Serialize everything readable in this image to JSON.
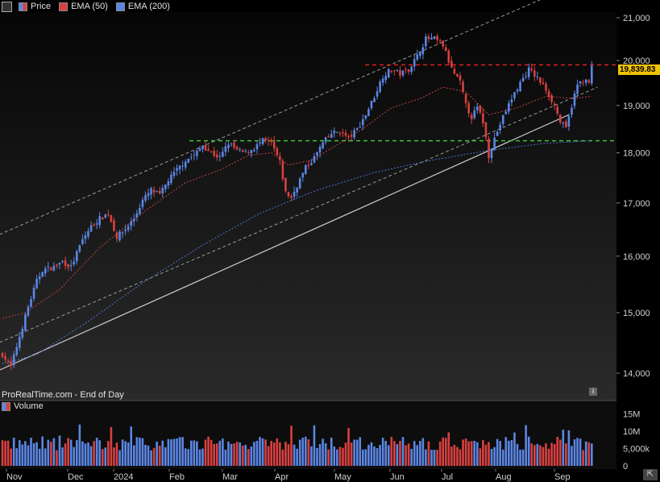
{
  "legend": [
    {
      "label": "Price",
      "color": "#d94040"
    },
    {
      "label": "EMA (50)",
      "color": "#d94040"
    },
    {
      "label": "EMA (200)",
      "color": "#5b86e5"
    }
  ],
  "source_label": "ProRealTime.com - End of Day",
  "volume_label": "Volume",
  "price_badge": "19,839.83",
  "colors": {
    "up": "#5b86e5",
    "down": "#d94040",
    "resistance": "#e02020",
    "support": "#3cc33c"
  },
  "chart_data": {
    "type": "candlestick",
    "price_axis": {
      "ticks": [
        14000,
        15000,
        16000,
        17000,
        18000,
        19000,
        20000,
        21000
      ],
      "tick_labels": [
        "14,000",
        "15,000",
        "16,000",
        "17,000",
        "18,000",
        "19,000",
        "20,000",
        "21,000"
      ],
      "scale": "log"
    },
    "volume_axis": {
      "ticks": [
        0,
        5000000,
        10000000,
        15000000
      ],
      "tick_labels": [
        "0",
        "5,000k",
        "10M",
        "15M"
      ]
    },
    "x_axis": {
      "labels": [
        "Nov",
        "Dec",
        "2024",
        "Feb",
        "Mar",
        "Apr",
        "May",
        "Jun",
        "Jul",
        "Aug",
        "Sep"
      ]
    },
    "last_price": 19839.83,
    "close_path": [
      [
        0,
        14300
      ],
      [
        3,
        14100
      ],
      [
        6,
        14600
      ],
      [
        9,
        15100
      ],
      [
        12,
        15550
      ],
      [
        14,
        15750
      ],
      [
        18,
        15800
      ],
      [
        21,
        15900
      ],
      [
        24,
        15800
      ],
      [
        28,
        16300
      ],
      [
        31,
        16550
      ],
      [
        34,
        16700
      ],
      [
        37,
        16800
      ],
      [
        40,
        16350
      ],
      [
        43,
        16500
      ],
      [
        46,
        16700
      ],
      [
        49,
        17050
      ],
      [
        52,
        17250
      ],
      [
        55,
        17150
      ],
      [
        58,
        17450
      ],
      [
        61,
        17650
      ],
      [
        64,
        17850
      ],
      [
        67,
        17950
      ],
      [
        70,
        18150
      ],
      [
        73,
        18000
      ],
      [
        76,
        17900
      ],
      [
        79,
        18200
      ],
      [
        82,
        18050
      ],
      [
        85,
        18000
      ],
      [
        88,
        18100
      ],
      [
        91,
        18250
      ],
      [
        94,
        18200
      ],
      [
        97,
        17800
      ],
      [
        99,
        17200
      ],
      [
        101,
        17100
      ],
      [
        103,
        17350
      ],
      [
        106,
        17700
      ],
      [
        109,
        17900
      ],
      [
        112,
        18200
      ],
      [
        115,
        18400
      ],
      [
        118,
        18450
      ],
      [
        121,
        18300
      ],
      [
        124,
        18500
      ],
      [
        127,
        18800
      ],
      [
        130,
        19200
      ],
      [
        133,
        19650
      ],
      [
        136,
        19800
      ],
      [
        139,
        19700
      ],
      [
        142,
        19800
      ],
      [
        145,
        20100
      ],
      [
        148,
        20500
      ],
      [
        151,
        20500
      ],
      [
        154,
        20350
      ],
      [
        157,
        19800
      ],
      [
        160,
        19500
      ],
      [
        162,
        19000
      ],
      [
        164,
        18750
      ],
      [
        166,
        18950
      ],
      [
        168,
        18650
      ],
      [
        170,
        17950
      ],
      [
        172,
        18300
      ],
      [
        175,
        18750
      ],
      [
        178,
        19150
      ],
      [
        181,
        19500
      ],
      [
        184,
        19800
      ],
      [
        187,
        19600
      ],
      [
        190,
        19350
      ],
      [
        193,
        19000
      ],
      [
        195,
        18650
      ],
      [
        197,
        18500
      ],
      [
        199,
        19000
      ],
      [
        201,
        19450
      ],
      [
        203,
        19550
      ],
      [
        205,
        19500
      ],
      [
        206,
        19839.83
      ]
    ],
    "ema50_path": [
      [
        0,
        14900
      ],
      [
        8,
        15000
      ],
      [
        20,
        15400
      ],
      [
        34,
        16150
      ],
      [
        50,
        16850
      ],
      [
        64,
        17400
      ],
      [
        76,
        17650
      ],
      [
        86,
        17950
      ],
      [
        94,
        18000
      ],
      [
        100,
        17750
      ],
      [
        108,
        17850
      ],
      [
        118,
        18200
      ],
      [
        126,
        18500
      ],
      [
        136,
        18950
      ],
      [
        146,
        19150
      ],
      [
        154,
        19400
      ],
      [
        162,
        19300
      ],
      [
        170,
        18800
      ],
      [
        180,
        18950
      ],
      [
        190,
        19200
      ],
      [
        200,
        19150
      ],
      [
        206,
        19200
      ]
    ],
    "ema200_path": [
      [
        0,
        14150
      ],
      [
        12,
        14300
      ],
      [
        30,
        14850
      ],
      [
        50,
        15550
      ],
      [
        70,
        16200
      ],
      [
        90,
        16800
      ],
      [
        110,
        17250
      ],
      [
        130,
        17600
      ],
      [
        150,
        17850
      ],
      [
        170,
        18050
      ],
      [
        190,
        18200
      ],
      [
        206,
        18250
      ]
    ],
    "trend_lines": {
      "upper_channel": [
        [
          -1,
          16400
        ],
        [
          195,
          21650
        ]
      ],
      "lower_channel": [
        [
          -1,
          14500
        ],
        [
          208,
          19400
        ]
      ],
      "support_line": [
        [
          -1,
          14050
        ],
        [
          198,
          18800
        ]
      ],
      "resistance_level": 19900,
      "support_level": 18250
    }
  }
}
